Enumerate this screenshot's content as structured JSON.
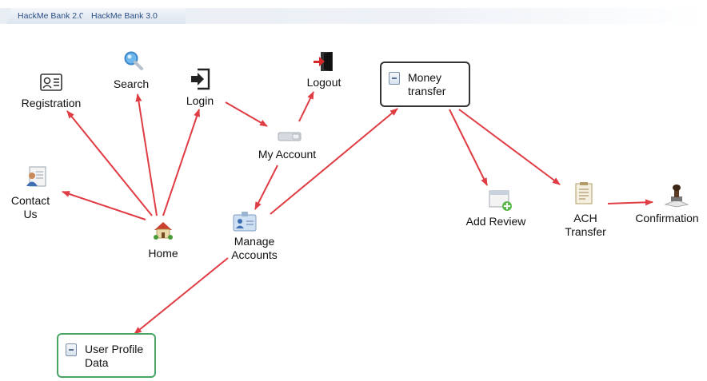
{
  "tabs": [
    {
      "label": "HackMe Bank 2.0"
    },
    {
      "label": "HackMe Bank 3.0"
    }
  ],
  "nodes": {
    "registration": "Registration",
    "search": "Search",
    "login": "Login",
    "logout": "Logout",
    "my_account": "My Account",
    "contact_us": "Contact\nUs",
    "home": "Home",
    "manage_accounts": "Manage\nAccounts",
    "money_transfer": "Money\ntransfer",
    "add_review": "Add Review",
    "ach_transfer": "ACH\nTransfer",
    "confirmation": "Confirmation",
    "user_profile_data": "User Profile\nData"
  },
  "colors": {
    "arrow": "#e03c44",
    "box_border": "#333333",
    "box_border_green": "#4aa564"
  },
  "icons": {
    "registration": "id-card-icon",
    "search": "magnifier-icon",
    "login": "login-door-icon",
    "logout": "logout-door-icon",
    "my_account": "wallet-icon",
    "contact_us": "contact-card-icon",
    "home": "house-icon",
    "manage_accounts": "badge-icon",
    "add_review": "window-add-icon",
    "ach_transfer": "document-icon",
    "confirmation": "stamp-icon"
  }
}
